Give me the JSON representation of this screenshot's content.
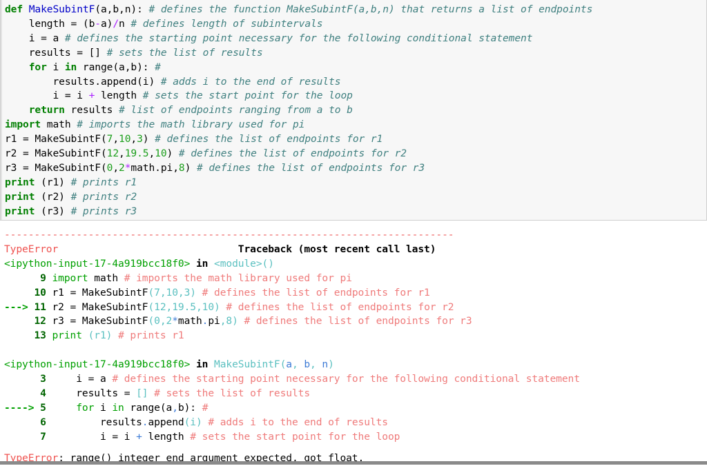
{
  "input_cell": {
    "prompt": "",
    "lines": [
      [
        {
          "t": "def ",
          "c": "kw"
        },
        {
          "t": "MakeSubintF",
          "c": "fname"
        },
        {
          "t": "(a,b,n): ",
          "c": "plain"
        },
        {
          "t": "# defines the function MakeSubintF(a,b,n) that returns a list of endpoints",
          "c": "cmt"
        }
      ],
      [
        {
          "t": "    length = (b",
          "c": "plain"
        },
        {
          "t": "-",
          "c": "op"
        },
        {
          "t": "a)",
          "c": "plain"
        },
        {
          "t": "/",
          "c": "op"
        },
        {
          "t": "n ",
          "c": "plain"
        },
        {
          "t": "# defines length of subintervals",
          "c": "cmt"
        }
      ],
      [
        {
          "t": "    i = a ",
          "c": "plain"
        },
        {
          "t": "# defines the starting point necessary for the following conditional statement",
          "c": "cmt"
        }
      ],
      [
        {
          "t": "    results = [] ",
          "c": "plain"
        },
        {
          "t": "# sets the list of results",
          "c": "cmt"
        }
      ],
      [
        {
          "t": "    ",
          "c": "plain"
        },
        {
          "t": "for",
          "c": "kw"
        },
        {
          "t": " i ",
          "c": "plain"
        },
        {
          "t": "in",
          "c": "kw"
        },
        {
          "t": " range(a,b): ",
          "c": "plain"
        },
        {
          "t": "#",
          "c": "cmt"
        }
      ],
      [
        {
          "t": "        results.append(i) ",
          "c": "plain"
        },
        {
          "t": "# adds i to the end of results",
          "c": "cmt"
        }
      ],
      [
        {
          "t": "        i = i ",
          "c": "plain"
        },
        {
          "t": "+",
          "c": "op"
        },
        {
          "t": " length ",
          "c": "plain"
        },
        {
          "t": "# sets the start point for the loop",
          "c": "cmt"
        }
      ],
      [
        {
          "t": "    ",
          "c": "plain"
        },
        {
          "t": "return",
          "c": "kw"
        },
        {
          "t": " results ",
          "c": "plain"
        },
        {
          "t": "# list of endpoints ranging from a to b",
          "c": "cmt"
        }
      ],
      [
        {
          "t": "import",
          "c": "kw"
        },
        {
          "t": " math ",
          "c": "plain"
        },
        {
          "t": "# imports the math library used for pi",
          "c": "cmt"
        }
      ],
      [
        {
          "t": "r1 = MakeSubintF(",
          "c": "plain"
        },
        {
          "t": "7",
          "c": "num"
        },
        {
          "t": ",",
          "c": "plain"
        },
        {
          "t": "10",
          "c": "num"
        },
        {
          "t": ",",
          "c": "plain"
        },
        {
          "t": "3",
          "c": "num"
        },
        {
          "t": ") ",
          "c": "plain"
        },
        {
          "t": "# defines the list of endpoints for r1",
          "c": "cmt"
        }
      ],
      [
        {
          "t": "r2 = MakeSubintF(",
          "c": "plain"
        },
        {
          "t": "12",
          "c": "num"
        },
        {
          "t": ",",
          "c": "plain"
        },
        {
          "t": "19.5",
          "c": "num"
        },
        {
          "t": ",",
          "c": "plain"
        },
        {
          "t": "10",
          "c": "num"
        },
        {
          "t": ") ",
          "c": "plain"
        },
        {
          "t": "# defines the list of endpoints for r2",
          "c": "cmt"
        }
      ],
      [
        {
          "t": "r3 = MakeSubintF(",
          "c": "plain"
        },
        {
          "t": "0",
          "c": "num"
        },
        {
          "t": ",",
          "c": "plain"
        },
        {
          "t": "2",
          "c": "num"
        },
        {
          "t": "*",
          "c": "op"
        },
        {
          "t": "math.pi,",
          "c": "plain"
        },
        {
          "t": "8",
          "c": "num"
        },
        {
          "t": ") ",
          "c": "plain"
        },
        {
          "t": "# defines the list of endpoints for r3",
          "c": "cmt"
        }
      ],
      [
        {
          "t": "print",
          "c": "kw"
        },
        {
          "t": " (r1) ",
          "c": "plain"
        },
        {
          "t": "# prints r1",
          "c": "cmt"
        }
      ],
      [
        {
          "t": "print",
          "c": "kw"
        },
        {
          "t": " (r2) ",
          "c": "plain"
        },
        {
          "t": "# prints r2",
          "c": "cmt"
        }
      ],
      [
        {
          "t": "print",
          "c": "kw"
        },
        {
          "t": " (r3) ",
          "c": "plain"
        },
        {
          "t": "# prints r3",
          "c": "cmt"
        }
      ]
    ]
  },
  "traceback": {
    "separator": "---------------------------------------------------------------------------",
    "error_type": "TypeError",
    "header_right": "Traceback (most recent call last)",
    "final_error_label": "TypeError",
    "final_error_message": ": range() integer end argument expected, got float.",
    "lines": [
      [
        {
          "t": "<ipython-input-17-4a919bcc18f0>",
          "c": "file"
        },
        {
          "t": " in ",
          "c": "inkw"
        },
        {
          "t": "<module>",
          "c": "scope"
        },
        {
          "t": "()",
          "c": "paren"
        }
      ],
      [
        {
          "t": "      ",
          "c": "tbplain"
        },
        {
          "t": "9",
          "c": "lno"
        },
        {
          "t": " ",
          "c": "tbplain"
        },
        {
          "t": "import",
          "c": "tbkw"
        },
        {
          "t": " math ",
          "c": "tbplain"
        },
        {
          "t": "# imports the math library used for pi",
          "c": "tbcmt"
        }
      ],
      [
        {
          "t": "     ",
          "c": "tbplain"
        },
        {
          "t": "10",
          "c": "lno"
        },
        {
          "t": " r1 ",
          "c": "tbplain"
        },
        {
          "t": "=",
          "c": "tbplain"
        },
        {
          "t": " MakeSubintF",
          "c": "tbplain"
        },
        {
          "t": "(",
          "c": "tbnum"
        },
        {
          "t": "7",
          "c": "tbnum"
        },
        {
          "t": ",",
          "c": "tbnum"
        },
        {
          "t": "10",
          "c": "tbnum"
        },
        {
          "t": ",",
          "c": "tbnum"
        },
        {
          "t": "3",
          "c": "tbnum"
        },
        {
          "t": ")",
          "c": "tbnum"
        },
        {
          "t": " ",
          "c": "tbplain"
        },
        {
          "t": "# defines the list of endpoints for r1",
          "c": "tbcmt"
        }
      ],
      [
        {
          "t": "---> ",
          "c": "arrow"
        },
        {
          "t": "11",
          "c": "lno"
        },
        {
          "t": " r2 = MakeSubintF",
          "c": "tbplain"
        },
        {
          "t": "(",
          "c": "tbnum"
        },
        {
          "t": "12",
          "c": "tbnum"
        },
        {
          "t": ",",
          "c": "tbnum"
        },
        {
          "t": "19.5",
          "c": "tbnum"
        },
        {
          "t": ",",
          "c": "tbnum"
        },
        {
          "t": "10",
          "c": "tbnum"
        },
        {
          "t": ")",
          "c": "tbnum"
        },
        {
          "t": " ",
          "c": "tbplain"
        },
        {
          "t": "# defines the list of endpoints for r2",
          "c": "tbcmt"
        }
      ],
      [
        {
          "t": "     ",
          "c": "tbplain"
        },
        {
          "t": "12",
          "c": "lno"
        },
        {
          "t": " r3 = MakeSubintF",
          "c": "tbplain"
        },
        {
          "t": "(",
          "c": "tbnum"
        },
        {
          "t": "0",
          "c": "tbnum"
        },
        {
          "t": ",",
          "c": "tbnum"
        },
        {
          "t": "2",
          "c": "tbnum"
        },
        {
          "t": "*",
          "c": "tbop"
        },
        {
          "t": "math",
          "c": "tbplain"
        },
        {
          "t": ".",
          "c": "tbop"
        },
        {
          "t": "pi",
          "c": "tbplain"
        },
        {
          "t": ",",
          "c": "tbnum"
        },
        {
          "t": "8",
          "c": "tbnum"
        },
        {
          "t": ")",
          "c": "tbnum"
        },
        {
          "t": " ",
          "c": "tbplain"
        },
        {
          "t": "# defines the list of endpoints for r3",
          "c": "tbcmt"
        }
      ],
      [
        {
          "t": "     ",
          "c": "tbplain"
        },
        {
          "t": "13",
          "c": "lno"
        },
        {
          "t": " ",
          "c": "tbplain"
        },
        {
          "t": "print",
          "c": "tbkw"
        },
        {
          "t": " ",
          "c": "tbplain"
        },
        {
          "t": "(r1)",
          "c": "tbnum"
        },
        {
          "t": " ",
          "c": "tbplain"
        },
        {
          "t": "# prints r1",
          "c": "tbcmt"
        }
      ]
    ],
    "frame2": [
      [
        {
          "t": "<ipython-input-17-4a919bcc18f0>",
          "c": "file"
        },
        {
          "t": " in ",
          "c": "inkw"
        },
        {
          "t": "MakeSubintF",
          "c": "scope"
        },
        {
          "t": "(",
          "c": "paren"
        },
        {
          "t": "a",
          "c": "arg"
        },
        {
          "t": ", ",
          "c": "paren"
        },
        {
          "t": "b",
          "c": "arg"
        },
        {
          "t": ", ",
          "c": "paren"
        },
        {
          "t": "n",
          "c": "arg"
        },
        {
          "t": ")",
          "c": "paren"
        }
      ],
      [
        {
          "t": "      ",
          "c": "tbplain"
        },
        {
          "t": "3",
          "c": "lno"
        },
        {
          "t": "     i = a ",
          "c": "tbplain"
        },
        {
          "t": "# defines the starting point necessary for the following conditional statement",
          "c": "tbcmt"
        }
      ],
      [
        {
          "t": "      ",
          "c": "tbplain"
        },
        {
          "t": "4",
          "c": "lno"
        },
        {
          "t": "     results = ",
          "c": "tbplain"
        },
        {
          "t": "[]",
          "c": "tbnum"
        },
        {
          "t": " ",
          "c": "tbplain"
        },
        {
          "t": "# sets the list of results",
          "c": "tbcmt"
        }
      ],
      [
        {
          "t": "----> ",
          "c": "arrow"
        },
        {
          "t": "5",
          "c": "lno"
        },
        {
          "t": "     ",
          "c": "tbplain"
        },
        {
          "t": "for",
          "c": "tbkw"
        },
        {
          "t": " i ",
          "c": "tbplain"
        },
        {
          "t": "in",
          "c": "tbkw"
        },
        {
          "t": " range(a",
          "c": "tbplain"
        },
        {
          "t": ",",
          "c": "tbop"
        },
        {
          "t": "b): ",
          "c": "tbplain"
        },
        {
          "t": "#",
          "c": "tbcmt"
        }
      ],
      [
        {
          "t": "      ",
          "c": "tbplain"
        },
        {
          "t": "6",
          "c": "lno"
        },
        {
          "t": "         results",
          "c": "tbplain"
        },
        {
          "t": ".",
          "c": "tbop"
        },
        {
          "t": "append",
          "c": "tbplain"
        },
        {
          "t": "(i)",
          "c": "tbnum"
        },
        {
          "t": " ",
          "c": "tbplain"
        },
        {
          "t": "# adds i to the end of results",
          "c": "tbcmt"
        }
      ],
      [
        {
          "t": "      ",
          "c": "tbplain"
        },
        {
          "t": "7",
          "c": "lno"
        },
        {
          "t": "         i = i ",
          "c": "tbplain"
        },
        {
          "t": "+",
          "c": "tbop"
        },
        {
          "t": " length ",
          "c": "tbplain"
        },
        {
          "t": "# sets the start point for the loop",
          "c": "tbcmt"
        }
      ]
    ]
  }
}
